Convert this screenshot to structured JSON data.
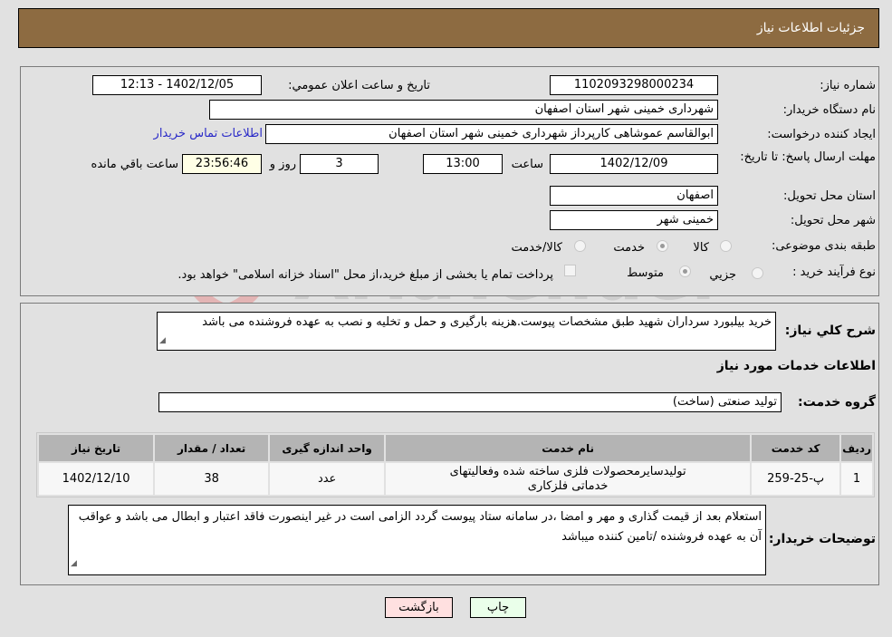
{
  "header": {
    "title": "جزئیات اطلاعات نیاز"
  },
  "form": {
    "need_number": {
      "label": "شماره نیاز:",
      "value": "1102093298000234"
    },
    "announce_datetime": {
      "label": "تاريخ و ساعت اعلان عمومي:",
      "value": "1402/12/05 - 12:13"
    },
    "buyer_org": {
      "label": "نام دستگاه خريدار:",
      "value": "شهرداری خمینی شهر استان اصفهان"
    },
    "requester": {
      "label": "ايجاد كننده درخواست:",
      "value": "ابوالقاسم عموشاهی کارپرداز شهرداری خمینی شهر استان اصفهان"
    },
    "contact_link": "اطلاعات تماس خريدار",
    "deadline": {
      "label": "مهلت ارسال پاسخ: تا تاريخ:",
      "date": "1402/12/09",
      "time_label": "ساعت",
      "time": "13:00",
      "days": "3",
      "days_label": "روز و",
      "remaining": "23:56:46",
      "remaining_label": "ساعت باقي مانده"
    },
    "delivery_province": {
      "label": "استان محل تحويل:",
      "value": "اصفهان"
    },
    "delivery_city": {
      "label": "شهر محل تحويل:",
      "value": "خمینی شهر"
    },
    "category": {
      "label": "طبقه بندی موضوعی:",
      "options": [
        "کالا",
        "خدمت",
        "کالا/خدمت"
      ],
      "selected": "خدمت"
    },
    "purchase_type": {
      "label": "نوع فرآيند خريد :",
      "options": [
        "جزيي",
        "متوسط"
      ],
      "selected": "متوسط",
      "payment_note": "پرداخت تمام يا بخشی از مبلغ خريد،از محل \"اسناد خزانه اسلامی\" خواهد بود.",
      "payment_checked": false
    }
  },
  "description": {
    "label": "شرح كلي نياز:",
    "value": "خريد بيلبورد سرداران شهيد طبق مشخصات پيوست.هزينه بارگيری و حمل و تخليه و نصب به عهده فروشنده می باشد"
  },
  "services": {
    "section_title": "اطلاعات خدمات مورد نياز",
    "group_label": "گروه خدمت:",
    "group_value": "تولید صنعتی (ساخت)",
    "columns": [
      "رديف",
      "كد خدمت",
      "نام خدمت",
      "واحد اندازه گيری",
      "تعداد / مقدار",
      "تاريخ نياز"
    ],
    "rows": [
      {
        "index": "1",
        "code": "پ-25-259",
        "name": "تولیدسایرمحصولات فلزی ساخته شده وفعالیتهای خدماتی فلزکاری",
        "unit": "عدد",
        "qty": "38",
        "date": "1402/12/10"
      }
    ]
  },
  "buyer_notes": {
    "label": "توضيحات خريدار:",
    "value": "استعلام بعد از قیمت گذاری و مهر و امضا ،در سامانه ستاد پیوست گردد الزامی است در غیر اینصورت فاقد اعتبار و ابطال می باشد و عواقب آن به عهده فروشنده /تامین کننده میباشد"
  },
  "buttons": {
    "print": "چاپ",
    "back": "بازگشت"
  },
  "colors": {
    "header_bg": "#8d6b41",
    "print_bg": "#eaffea",
    "back_bg": "#ffe0e0",
    "link": "#2b2bc8"
  },
  "watermark": "AriaTender.neT"
}
